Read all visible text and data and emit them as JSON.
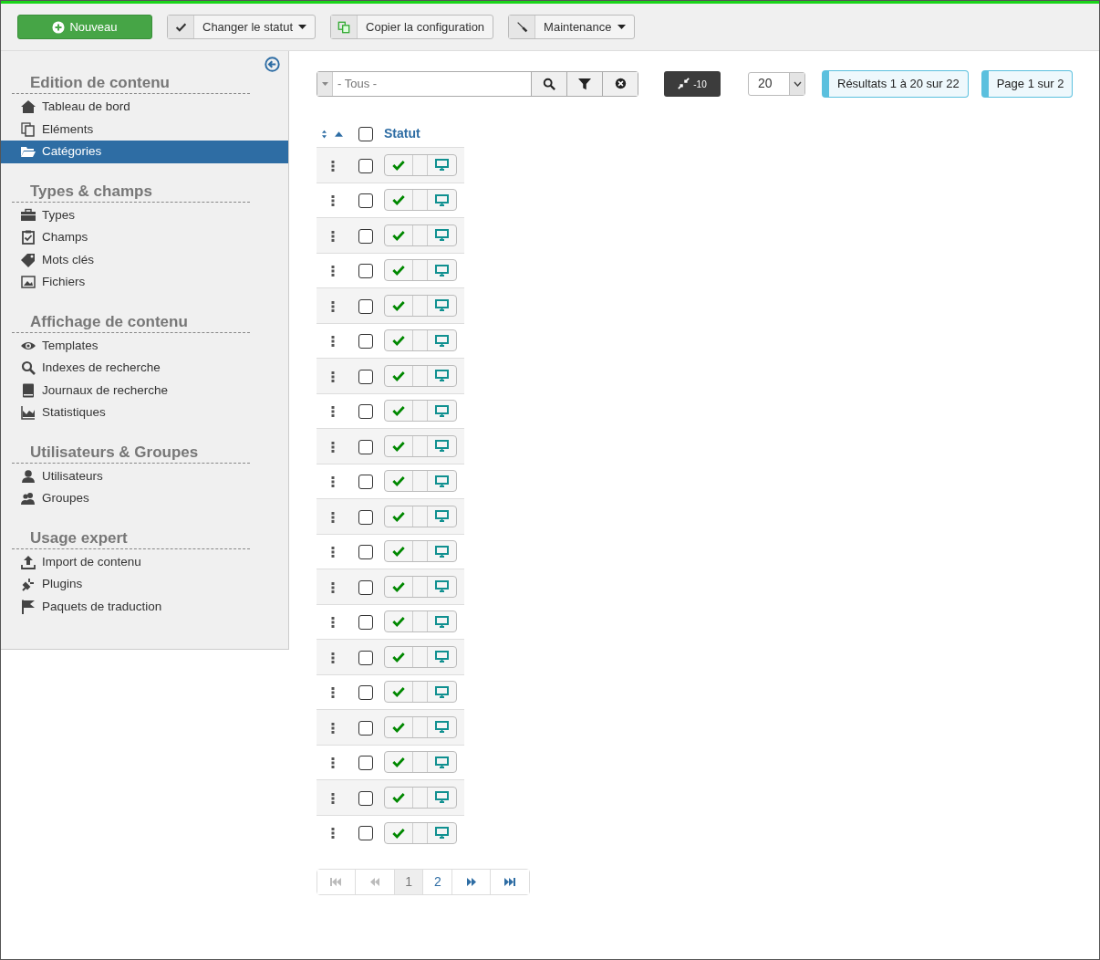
{
  "toolbar": [
    {
      "label": "Nouveau",
      "kind": "new",
      "dropdown": false
    },
    {
      "label": "Changer le statut",
      "kind": "check",
      "dropdown": true
    },
    {
      "label": "Copier la configuration",
      "kind": "copy",
      "dropdown": false
    },
    {
      "label": "Maintenance",
      "kind": "tool",
      "dropdown": true
    }
  ],
  "sidebar": {
    "sections": [
      {
        "title": "Edition de contenu",
        "items": [
          {
            "label": "Tableau de bord",
            "selected": false
          },
          {
            "label": "Eléments",
            "selected": false
          },
          {
            "label": "Catégories",
            "selected": true
          }
        ]
      },
      {
        "title": "Types & champs",
        "items": [
          {
            "label": "Types",
            "selected": false
          },
          {
            "label": "Champs",
            "selected": false
          },
          {
            "label": "Mots clés",
            "selected": false
          },
          {
            "label": "Fichiers",
            "selected": false
          }
        ]
      },
      {
        "title": "Affichage de contenu",
        "items": [
          {
            "label": "Templates",
            "selected": false
          },
          {
            "label": "Indexes de recherche",
            "selected": false
          },
          {
            "label": "Journaux de recherche",
            "selected": false
          },
          {
            "label": "Statistiques",
            "selected": false
          }
        ]
      },
      {
        "title": "Utilisateurs & Groupes",
        "items": [
          {
            "label": "Utilisateurs",
            "selected": false
          },
          {
            "label": "Groupes",
            "selected": false
          }
        ]
      },
      {
        "title": "Usage expert",
        "items": [
          {
            "label": "Import de contenu",
            "selected": false
          },
          {
            "label": "Plugins",
            "selected": false
          },
          {
            "label": "Paquets de traduction",
            "selected": false
          }
        ]
      }
    ]
  },
  "filter": {
    "placeholder": "- Tous -",
    "compact_label": "-10",
    "per_page": "20",
    "results": "Résultats 1 à 20 sur 22",
    "page_info": "Page 1 sur 2"
  },
  "table": {
    "column": "Statut",
    "all_checked": false,
    "rows": [
      {
        "checked": false,
        "published": true
      },
      {
        "checked": false,
        "published": true
      },
      {
        "checked": false,
        "published": true
      },
      {
        "checked": false,
        "published": true
      },
      {
        "checked": false,
        "published": true
      },
      {
        "checked": false,
        "published": true
      },
      {
        "checked": false,
        "published": true
      },
      {
        "checked": false,
        "published": true
      },
      {
        "checked": false,
        "published": true
      },
      {
        "checked": false,
        "published": true
      },
      {
        "checked": false,
        "published": true
      },
      {
        "checked": false,
        "published": true
      },
      {
        "checked": false,
        "published": true
      },
      {
        "checked": false,
        "published": true
      },
      {
        "checked": false,
        "published": true
      },
      {
        "checked": false,
        "published": true
      },
      {
        "checked": false,
        "published": true
      },
      {
        "checked": false,
        "published": true
      },
      {
        "checked": false,
        "published": true
      },
      {
        "checked": false,
        "published": true
      }
    ]
  },
  "pagination": {
    "first_disabled": true,
    "prev_disabled": true,
    "pages": [
      {
        "label": "1",
        "selected": true
      },
      {
        "label": "2",
        "selected": false
      }
    ]
  }
}
